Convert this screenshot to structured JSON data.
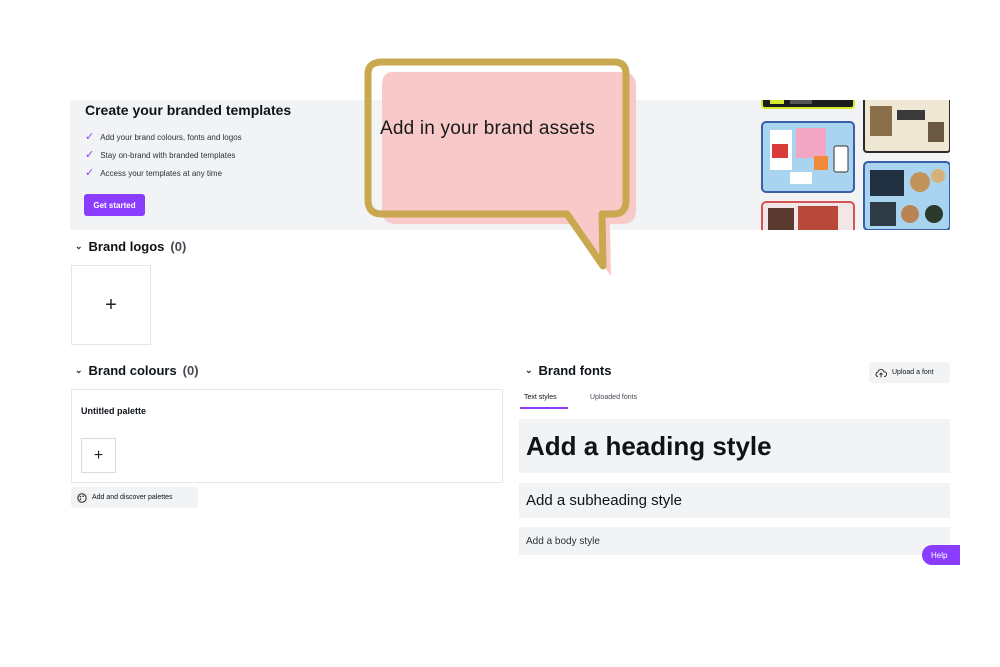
{
  "banner": {
    "title": "Create your branded templates",
    "features": [
      "Add your brand colours, fonts and logos",
      "Stay on-brand with branded templates",
      "Access your templates at any time"
    ],
    "cta_label": "Get started"
  },
  "brand_logos": {
    "title": "Brand logos",
    "count": "(0)"
  },
  "brand_colours": {
    "title": "Brand colours",
    "count": "(0)",
    "palette_title": "Untitled palette",
    "discover_label": "Add and discover palettes"
  },
  "brand_fonts": {
    "title": "Brand fonts",
    "upload_label": "Upload a font",
    "tabs": [
      {
        "label": "Text styles",
        "active": true
      },
      {
        "label": "Uploaded fonts",
        "active": false
      }
    ],
    "heading_style": "Add a heading style",
    "subheading_style": "Add a subheading style",
    "body_style": "Add a body style"
  },
  "help_label": "Help",
  "callout": {
    "text": "Add in your brand assets"
  },
  "colors": {
    "accent": "#8b3dff",
    "panel_bg": "#f2f3f5",
    "callout_fill": "#f7c9c9",
    "callout_border": "#c9a84f"
  },
  "icons": [
    "check-icon",
    "chevron-down-icon",
    "plus-icon",
    "palette-icon",
    "cloud-upload-icon",
    "help-icon"
  ]
}
